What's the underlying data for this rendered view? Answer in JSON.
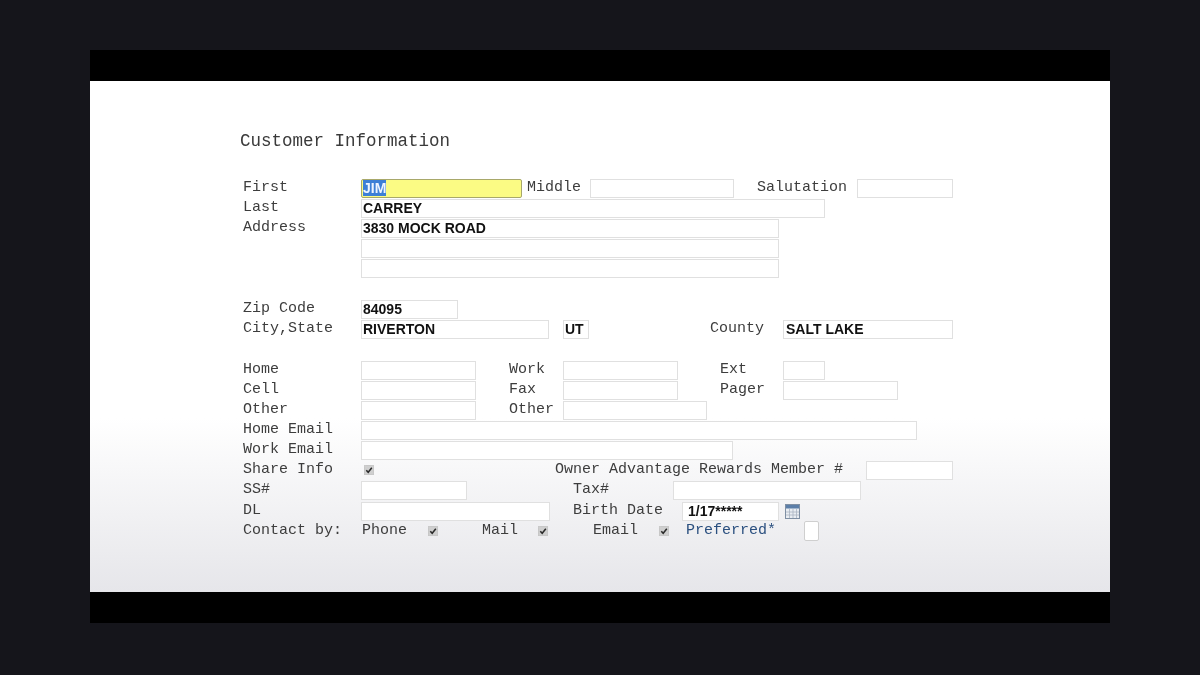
{
  "title": "Customer Information",
  "name": {
    "first": {
      "label": "First",
      "value": "JIM",
      "focused": true,
      "text_selected": true
    },
    "middle": {
      "label": "Middle",
      "focused": false
    },
    "salutation": {
      "label": "Salutation",
      "focused": false
    },
    "last": {
      "label": "Last",
      "value": "CARREY",
      "focused": false
    }
  },
  "address": {
    "label": "Address",
    "lines": [
      {
        "value": "3830 MOCK ROAD",
        "focused": false
      },
      {
        "focused": false
      },
      {
        "focused": false
      }
    ]
  },
  "location": {
    "zip_code": {
      "label": "Zip Code",
      "value": "84095",
      "focused": false
    },
    "city_state": {
      "label": "City,State",
      "city": {
        "value": "RIVERTON",
        "focused": false
      },
      "state": {
        "value": "UT",
        "focused": false
      }
    },
    "county": {
      "label": "County",
      "value": "SALT LAKE",
      "focused": false
    }
  },
  "phones": {
    "home": {
      "label": "Home",
      "focused": false
    },
    "work": {
      "label": "Work",
      "focused": false
    },
    "ext": {
      "label": "Ext",
      "focused": false
    },
    "cell": {
      "label": "Cell",
      "focused": false
    },
    "fax": {
      "label": "Fax",
      "focused": false
    },
    "pager": {
      "label": "Pager",
      "focused": false
    },
    "other": {
      "label": "Other",
      "focused": false
    },
    "other_2": {
      "label": "Other",
      "focused": false
    }
  },
  "emails": {
    "home_email": {
      "label": "Home Email",
      "focused": false
    },
    "work_email": {
      "label": "Work Email",
      "focused": false
    }
  },
  "share_info": {
    "label": "Share Info",
    "checked": true
  },
  "rewards_member": {
    "label": "Owner Advantage Rewards Member #",
    "focused": false
  },
  "ss": {
    "label": "SS#",
    "focused": false
  },
  "tax": {
    "label": "Tax#",
    "focused": false
  },
  "dl": {
    "label": "DL",
    "focused": false
  },
  "birth_date": {
    "label": "Birth Date",
    "value": "1/17*****",
    "focused": false
  },
  "contact_by": {
    "label": "Contact by:",
    "options": [
      {
        "label": "Phone",
        "checked": true,
        "kind": "standard"
      },
      {
        "label": "Mail",
        "checked": true,
        "kind": "standard"
      },
      {
        "label": "Email",
        "checked": true,
        "kind": "standard"
      },
      {
        "label": "Preferred*",
        "checked": false,
        "kind": "emphasized"
      }
    ]
  }
}
